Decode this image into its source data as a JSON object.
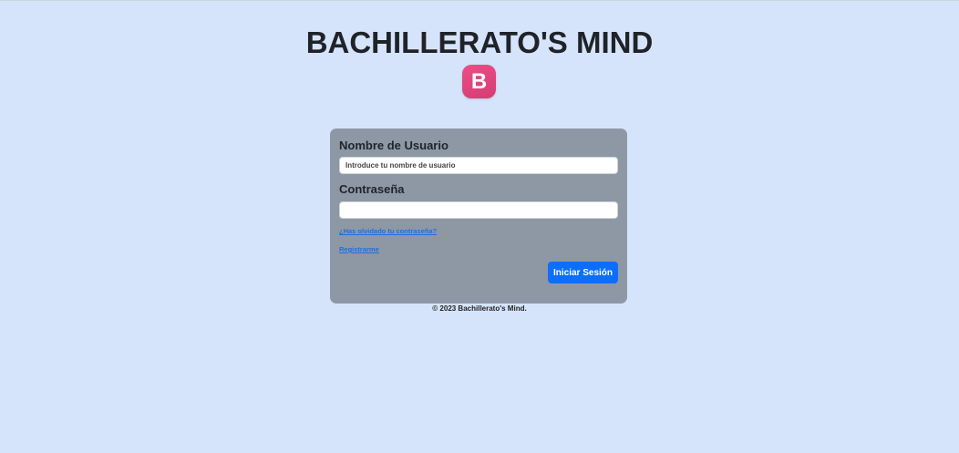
{
  "header": {
    "title": "BACHILLERATO'S MIND",
    "logo_letter": "B"
  },
  "login": {
    "username_label": "Nombre de Usuario",
    "username_placeholder": "Introduce tu nombre de usuario",
    "username_value": "",
    "password_label": "Contraseña",
    "password_value": "",
    "forgot_link": "¿Has olvidado tu contraseña?",
    "register_link": "Registrarme",
    "submit_label": "Iniciar Sesión"
  },
  "footer": {
    "copyright": "© 2023 Bachillerato's Mind."
  },
  "colors": {
    "background": "#d6e4fb",
    "card": "#8e98a5",
    "logo": "#e2467e",
    "primary_button": "#0d6efd",
    "link": "#1a6fe6"
  }
}
